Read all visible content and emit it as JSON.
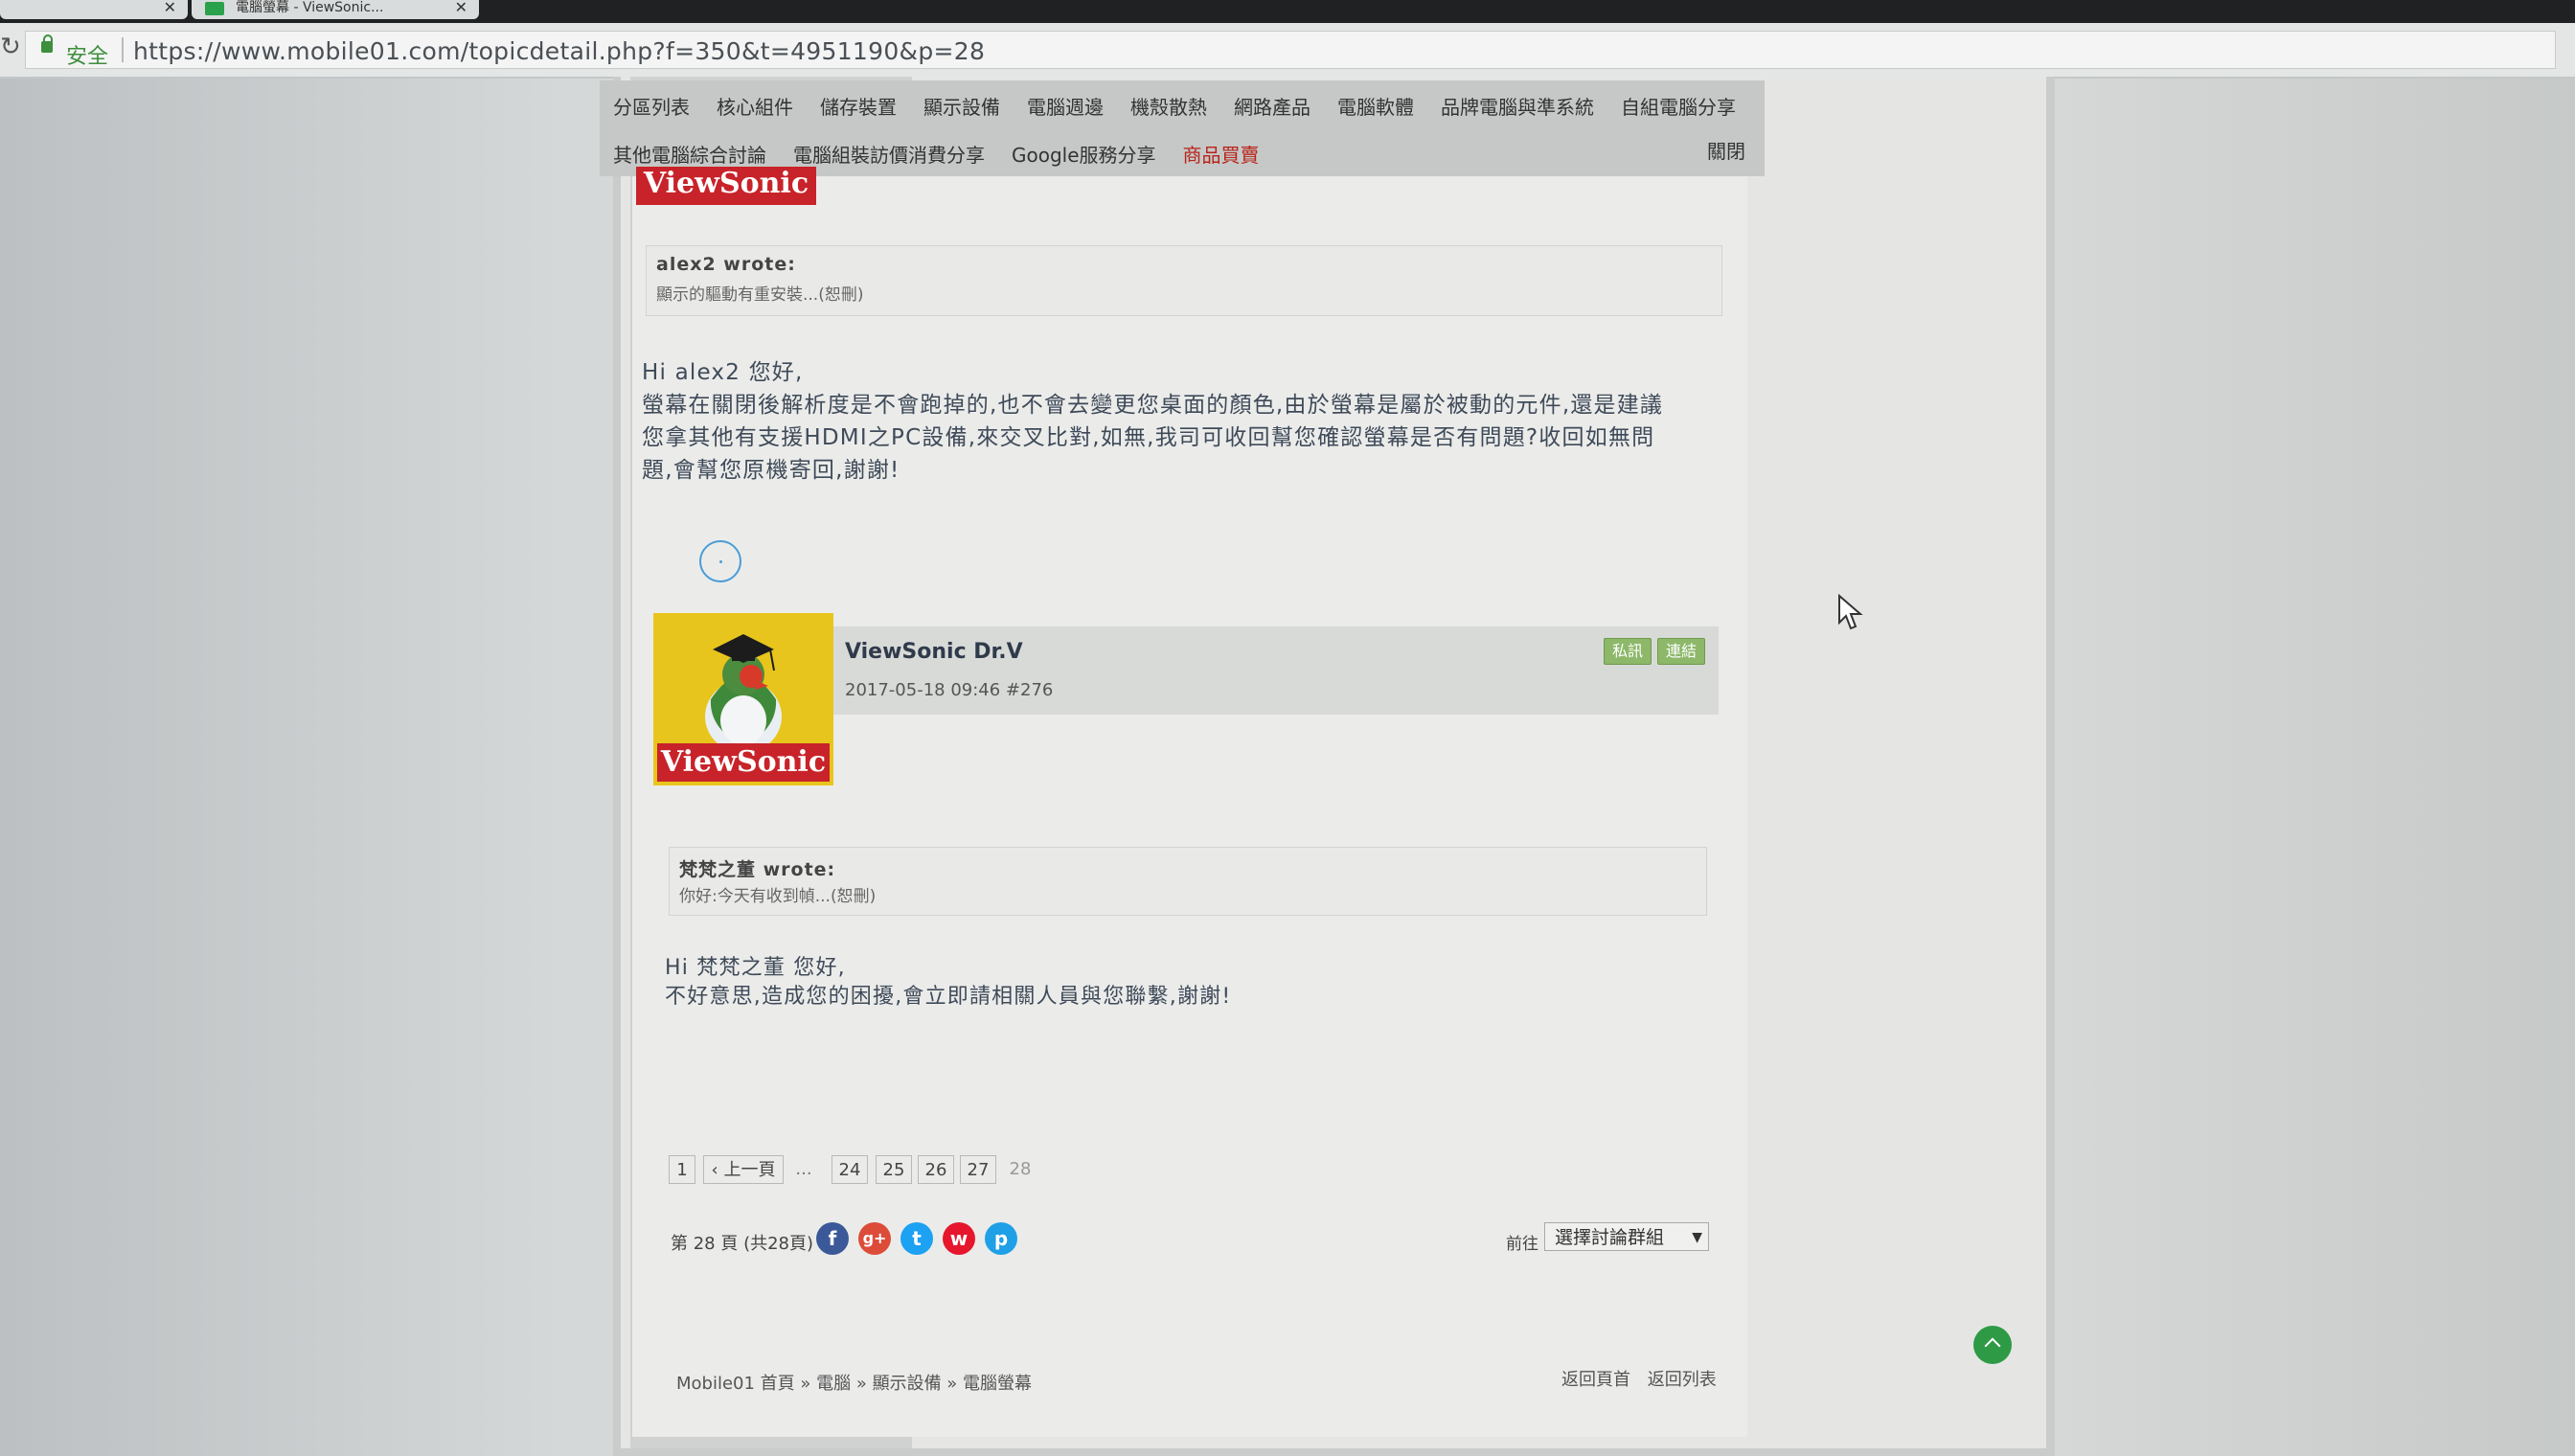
{
  "browser": {
    "tab_title": "電腦螢幕 - ViewSonic...",
    "close_glyph": "✕",
    "secure_label": "安全",
    "url": "https://www.mobile01.com/topicdetail.php?f=350&t=4951190&p=28"
  },
  "nav": {
    "row1": [
      "分區列表",
      "核心組件",
      "儲存裝置",
      "顯示設備",
      "電腦週邊",
      "機殼散熱",
      "網路產品",
      "電腦軟體",
      "品牌電腦與準系統",
      "自組電腦分享"
    ],
    "row2": [
      "其他電腦綜合討論",
      "電腦組裝訪價消費分享",
      "Google服務分享",
      "商品買賣"
    ],
    "close": "關閉"
  },
  "logo_text": "ViewSonic",
  "post1": {
    "quote_author": "alex2 wrote:",
    "quote_text": "顯示的驅動有重安裝...(恕刪)",
    "lines": [
      "Hi alex2 您好,",
      "螢幕在關閉後解析度是不會跑掉的,也不會去變更您桌面的顏色,由於螢幕是屬於被動的元件,還是建議",
      "您拿其他有支援HDMI之PC設備,來交叉比對,如無,我司可收回幫您確認螢幕是否有問題?收回如無問",
      "題,會幫您原機寄回,謝謝!"
    ]
  },
  "post2": {
    "author": "ViewSonic Dr.V",
    "meta": "2017-05-18 09:46  #276",
    "btn_message": "私訊",
    "btn_link": "連結",
    "quote_author": "梵梵之董 wrote:",
    "quote_text": "你好:今天有收到幀...(恕刪)",
    "lines": [
      "Hi 梵梵之董 您好,",
      "不好意思,造成您的困擾,會立即請相關人員與您聯繫,謝謝!"
    ]
  },
  "pager": {
    "first": "1",
    "prev": "‹ 上一頁",
    "ellipsis": "...",
    "pages": [
      "24",
      "25",
      "26",
      "27"
    ],
    "current": "28"
  },
  "share": {
    "label": "第 28 頁 (共28頁)",
    "icons": [
      {
        "name": "facebook-icon",
        "glyph": "f",
        "color": "#3b5998"
      },
      {
        "name": "google-plus-icon",
        "glyph": "g+",
        "color": "#dd4b39"
      },
      {
        "name": "twitter-icon",
        "glyph": "t",
        "color": "#1da1f2"
      },
      {
        "name": "weibo-icon",
        "glyph": "w",
        "color": "#e6162d"
      },
      {
        "name": "plurk-icon",
        "glyph": "p",
        "color": "#1fa0e6"
      }
    ]
  },
  "goto": {
    "label": "前往",
    "selected": "選擇討論群組"
  },
  "footer": {
    "breadcrumb": "Mobile01 首頁 » 電腦 » 顯示設備 » 電腦螢幕",
    "back_home": "返回頁首",
    "back_list": "返回列表"
  }
}
